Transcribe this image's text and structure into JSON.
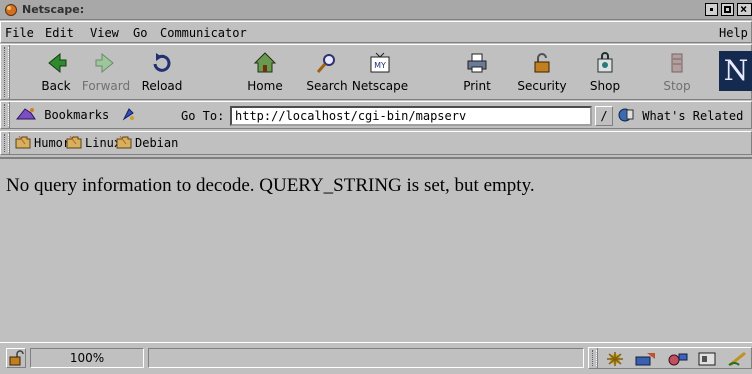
{
  "window": {
    "title": "Netscape:"
  },
  "menu": {
    "file": "File",
    "edit": "Edit",
    "view": "View",
    "go": "Go",
    "communicator": "Communicator",
    "help": "Help"
  },
  "toolbar": {
    "back": "Back",
    "forward": "Forward",
    "reload": "Reload",
    "home": "Home",
    "search": "Search",
    "netscape": "Netscape",
    "print": "Print",
    "security": "Security",
    "shop": "Shop",
    "stop": "Stop",
    "logo": "N"
  },
  "location": {
    "bookmarks_label": "Bookmarks",
    "goto_label": "Go To:",
    "url": "http://localhost/cgi-bin/mapserv",
    "whats_related": "What's Related"
  },
  "personal_toolbar": {
    "items": [
      {
        "label": "Humor"
      },
      {
        "label": "Linux"
      },
      {
        "label": "Debian"
      }
    ]
  },
  "content": {
    "message": "No query information to decode. QUERY_STRING is set, but empty."
  },
  "status": {
    "progress": "100%",
    "text": ""
  },
  "colors": {
    "chrome": "#c0c0c0",
    "titlebar": "#a8a8a8",
    "logo_bg": "#152a4f"
  }
}
